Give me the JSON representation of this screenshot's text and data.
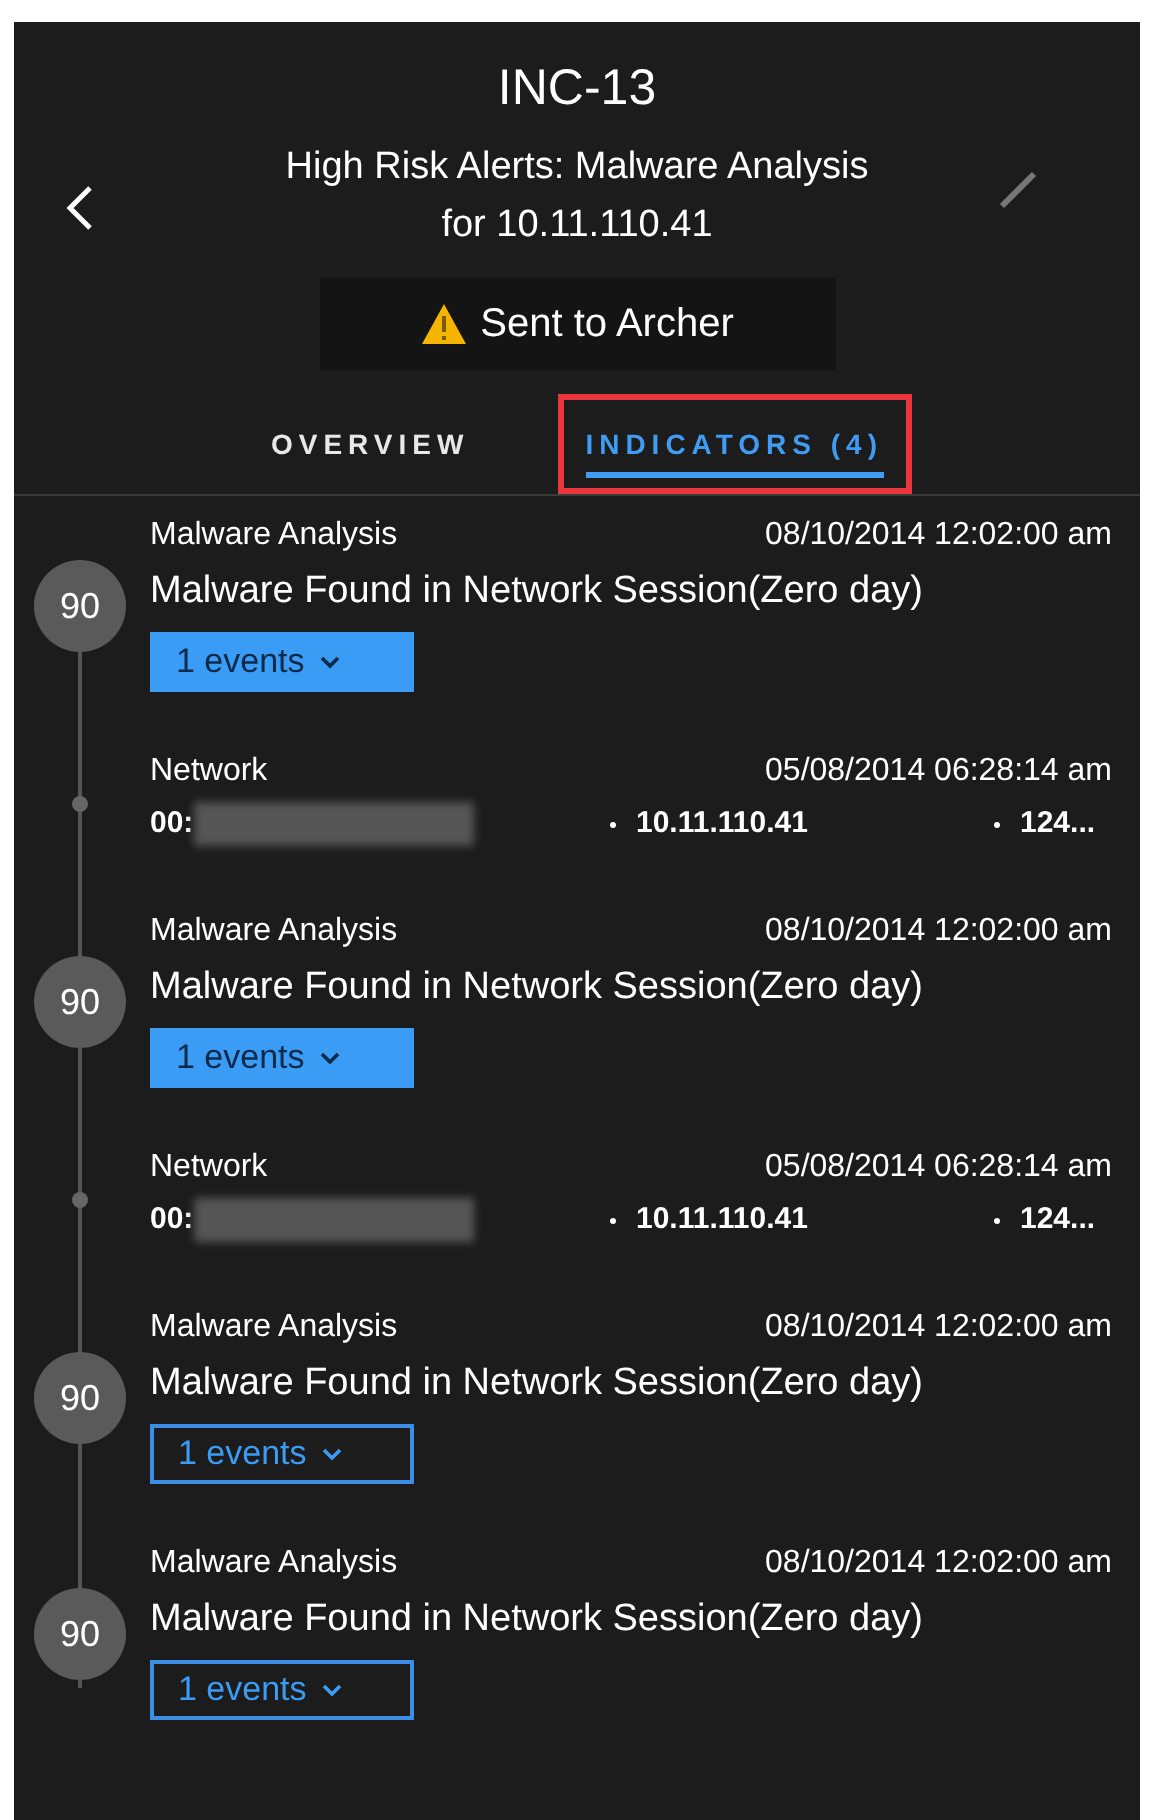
{
  "incident": {
    "id": "INC-13",
    "title": "High Risk Alerts: Malware Analysis for 10.11.110.41",
    "status": "Sent to Archer"
  },
  "tabs": [
    {
      "label": "OVERVIEW",
      "selected": false,
      "outlined": false
    },
    {
      "label": "INDICATORS (4)",
      "selected": true,
      "outlined": true
    }
  ],
  "indicators": [
    {
      "kind": "alert",
      "source": "Malware Analysis",
      "time": "08/10/2014 12:02:00 am",
      "score": "90",
      "name": "Malware Found in Network Session(Zero day)",
      "events": "1 events",
      "highlighted": true
    },
    {
      "kind": "network",
      "source": "Network",
      "time": "05/08/2014 06:28:14 am",
      "fields": [
        {
          "text": "00:",
          "redacted": true
        },
        {
          "text": "10.11.110.41",
          "redacted": false
        },
        {
          "text": "124...",
          "redacted": false
        }
      ]
    },
    {
      "kind": "alert",
      "source": "Malware Analysis",
      "time": "08/10/2014 12:02:00 am",
      "score": "90",
      "name": "Malware Found in Network Session(Zero day)",
      "events": "1 events",
      "highlighted": true
    },
    {
      "kind": "network",
      "source": "Network",
      "time": "05/08/2014 06:28:14 am",
      "fields": [
        {
          "text": "00:",
          "redacted": true
        },
        {
          "text": "10.11.110.41",
          "redacted": false
        },
        {
          "text": "124...",
          "redacted": false
        }
      ]
    },
    {
      "kind": "alert",
      "source": "Malware Analysis",
      "time": "08/10/2014 12:02:00 am",
      "score": "90",
      "name": "Malware Found in Network Session(Zero day)",
      "events": "1 events",
      "highlighted": false
    },
    {
      "kind": "alert",
      "source": "Malware Analysis",
      "time": "08/10/2014 12:02:00 am",
      "score": "90",
      "name": "Malware Found in Network Session(Zero day)",
      "events": "1 events",
      "highlighted": false
    }
  ]
}
